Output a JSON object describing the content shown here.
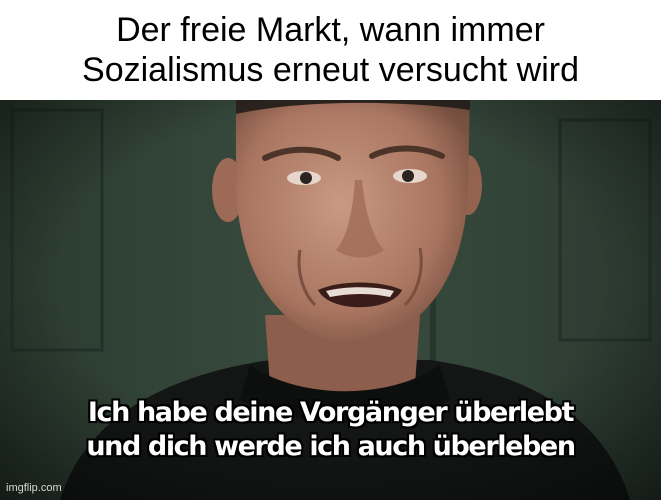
{
  "meme": {
    "top_caption": {
      "line1": "Der freie Markt, wann immer",
      "line2": "Sozialismus erneut versucht wird"
    },
    "bottom_caption": {
      "line1": "Ich habe deine Vorgänger überlebt",
      "line2": "und dich werde ich auch überleben"
    },
    "watermark": "imgflip.com"
  },
  "colors": {
    "background": "#ffffff",
    "wall": "#2b3a30",
    "suit": "#141616",
    "skin": "#b5836c"
  }
}
